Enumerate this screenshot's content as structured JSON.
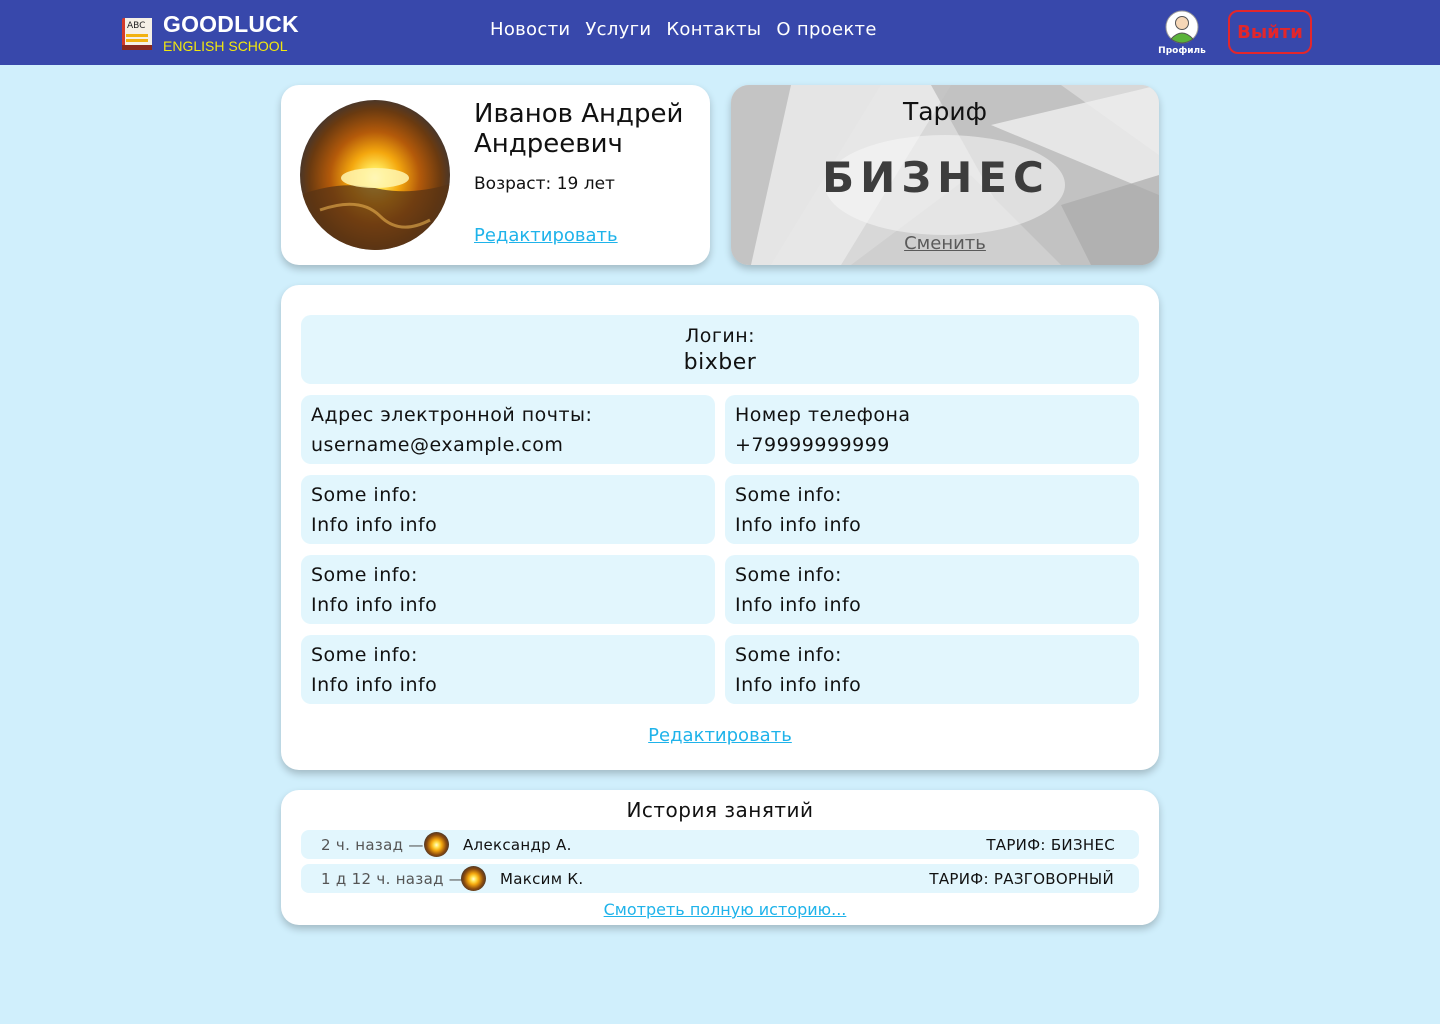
{
  "header": {
    "logo_main": "GOODLUCK",
    "logo_sub": "ENGLISH SCHOOL",
    "logo_book_text": "ABC",
    "nav": [
      "Новости",
      "Услуги",
      "Контакты",
      "О проекте"
    ],
    "profile_label": "Профиль",
    "logout_label": "Выйти",
    "colors": {
      "background": "#3848ab",
      "logo_sub": "#f2e80e",
      "logout": "#e3262b"
    }
  },
  "profile": {
    "name": "Иванов Андрей Андреевич",
    "name_line1": "Иванов Андрей",
    "name_line2": "Андреевич",
    "age_text": "Возраст: 19 лет",
    "edit_label": "Редактировать"
  },
  "tariff": {
    "title": "Тариф",
    "name": "БИЗНЕС",
    "change_label": "Сменить"
  },
  "info": {
    "login_label": "Логин:",
    "login_value": "bixber",
    "fields": [
      {
        "label": "Адрес электронной почты:",
        "value": "username@example.com"
      },
      {
        "label": "Номер телефона",
        "value": "+79999999999"
      },
      {
        "label": "Some info:",
        "value": "Info info info"
      },
      {
        "label": "Some info:",
        "value": "Info info info"
      },
      {
        "label": "Some info:",
        "value": "Info info info"
      },
      {
        "label": "Some info:",
        "value": "Info info info"
      },
      {
        "label": "Some info:",
        "value": "Info info info"
      },
      {
        "label": "Some info:",
        "value": "Info info info"
      }
    ],
    "edit_label": "Редактировать"
  },
  "history": {
    "title": "История занятий",
    "rows": [
      {
        "time": "2 ч. назад —",
        "teacher": "Александр А.",
        "tariff": "ТАРИФ: БИЗНЕС"
      },
      {
        "time": "1 д 12 ч. назад —",
        "teacher": "Максим К.",
        "tariff": "ТАРИФ: РАЗГОВОРНЫЙ"
      }
    ],
    "full_link": "Смотреть полную историю..."
  },
  "colors": {
    "page_background": "#d0effc",
    "link": "#1fb3ea",
    "tile": "#e2f6fd"
  }
}
